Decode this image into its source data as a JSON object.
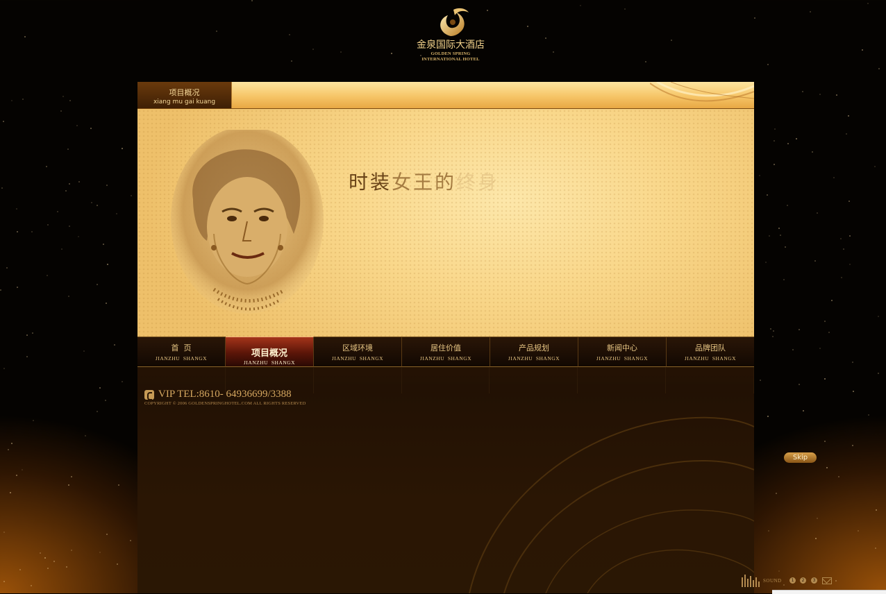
{
  "logo": {
    "name_cn": "金泉国际大酒店",
    "name_en_line1": "GOLDEN SPRING",
    "name_en_line2": "INTERNATIONAL HOTEL"
  },
  "section": {
    "title_cn": "项目概况",
    "title_pinyin": "xiang mu gai kuang"
  },
  "banner": {
    "title_part1": "时装",
    "title_part2": "女王的",
    "title_part3": "终身"
  },
  "nav": {
    "items": [
      {
        "label": "首  页",
        "sub": "JIANZHU  SHANGX",
        "active": false
      },
      {
        "label": "项目概况",
        "sub": "JIANZHU  SHANGX",
        "active": true
      },
      {
        "label": "区域环境",
        "sub": "JIANZHU  SHANGX",
        "active": false
      },
      {
        "label": "居住价值",
        "sub": "JIANZHU  SHANGX",
        "active": false
      },
      {
        "label": "产品规划",
        "sub": "JIANZHU  SHANGX",
        "active": false
      },
      {
        "label": "新闻中心",
        "sub": "JIANZHU  SHANGX",
        "active": false
      },
      {
        "label": "品牌团队",
        "sub": "JIANZHU  SHANGX",
        "active": false
      }
    ]
  },
  "footer": {
    "tel": "VIP TEL:8610- 64936699/3388",
    "copyright": "COPYRIGHT © 2006  GOLDENSPRINGHOTEL.COM  ALL RIGHTS RESERVED"
  },
  "skip_label": "Skip",
  "sound": {
    "label": "SOUND",
    "buttons": [
      "1",
      "2",
      "3"
    ]
  },
  "colors": {
    "gold": "#f6c567",
    "dark_brown": "#2a1604",
    "active_red": "#a4341a"
  }
}
